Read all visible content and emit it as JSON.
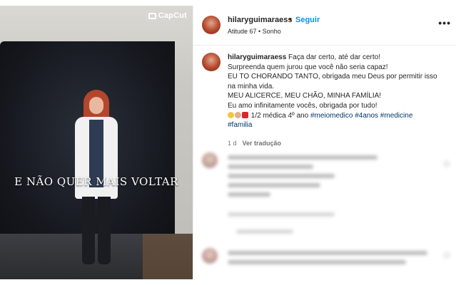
{
  "media": {
    "brand": "CapCut",
    "caption": "E NÃO QUER MAIS VOLTAR"
  },
  "header": {
    "username": "hilaryguimaraess",
    "separator": "•",
    "follow_label": "Seguir",
    "subline": "Atitude 67 • Sonho",
    "more_icon": "more-options-icon"
  },
  "post": {
    "username": "hilaryguimaraess",
    "lines": [
      "Faça dar certo, até dar certo!",
      "Surpreenda quem jurou que você não seria capaz!",
      "EU TO CHORANDO TANTO, obrigada meu Deus por permitir isso",
      "na minha vida.",
      "MEU ALICERCE, MEU CHÃO, MINHA FAMÍLIA!",
      "Eu amo infinitamente vocês, obrigada por tudo!"
    ],
    "line7_text": "1/2 médica 4º ano",
    "hashtags": [
      "#meiomedico",
      "#4anos",
      "#medicine",
      "#familia"
    ],
    "emojis": [
      "crying-face",
      "folded-hands",
      "red-heart"
    ],
    "time": "1 d",
    "translate_label": "Ver tradução"
  },
  "colors": {
    "link": "#0095f6",
    "hashtag": "#00376b",
    "text": "#262626",
    "muted": "#737373"
  }
}
